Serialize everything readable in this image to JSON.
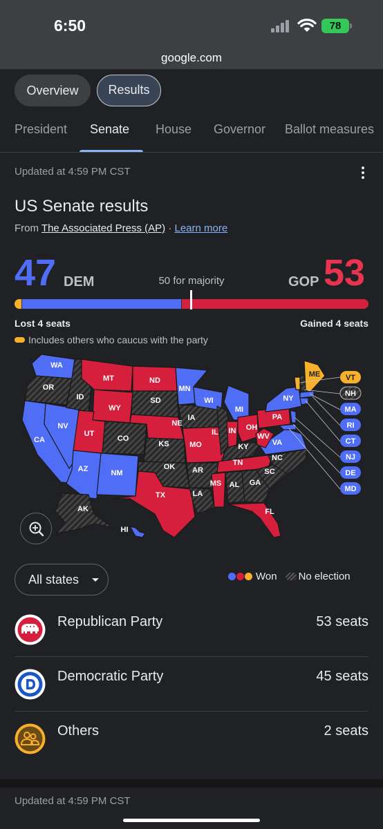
{
  "status": {
    "time": "6:50",
    "battery": "78"
  },
  "browser": {
    "url": "google.com"
  },
  "view_toggle": {
    "overview": "Overview",
    "results": "Results"
  },
  "race_tabs": [
    {
      "label": "President"
    },
    {
      "label": "Senate"
    },
    {
      "label": "House"
    },
    {
      "label": "Governor"
    },
    {
      "label": "Ballot measures"
    }
  ],
  "header": {
    "updated": "Updated at 4:59 PM CST",
    "title": "US Senate results",
    "source_prefix": "From",
    "source_name": "The Associated Press (AP)",
    "source_sep": "·",
    "learn_more": "Learn more"
  },
  "tally": {
    "dem_seats": "47",
    "dem_label": "DEM",
    "majority": "50 for majority",
    "gop_label": "GOP",
    "gop_seats": "53",
    "total_seats": 100,
    "bar": {
      "others": 2,
      "dem": 45,
      "gop": 53
    },
    "dem_change": "Lost 4 seats",
    "gop_change": "Gained 4 seats",
    "others_note": "Includes others who caucus with the party"
  },
  "colors": {
    "dem": "#4f6df5",
    "gop": "#d61f3c",
    "others": "#f6b02b",
    "no_election": "#2f2f2f"
  },
  "map": {
    "state_labels": [
      "WA",
      "OR",
      "MT",
      "ND",
      "ID",
      "MN",
      "WI",
      "MI",
      "NY",
      "ME",
      "SD",
      "WY",
      "NV",
      "CA",
      "UT",
      "CO",
      "NE",
      "IA",
      "IL",
      "IN",
      "OH",
      "PA",
      "KS",
      "MO",
      "KY",
      "WV",
      "VA",
      "NC",
      "TN",
      "AZ",
      "NM",
      "OK",
      "AR",
      "SC",
      "MS",
      "AL",
      "GA",
      "TX",
      "LA",
      "FL",
      "AK",
      "HI"
    ],
    "northeast_labels": [
      "VT",
      "NH",
      "MA",
      "RI",
      "CT",
      "NJ",
      "DE",
      "MD"
    ]
  },
  "filter": {
    "label": "All states"
  },
  "legend": {
    "won": "Won",
    "no_election": "No election"
  },
  "parties": [
    {
      "name": "Republican Party",
      "seats": "53 seats",
      "icon": "elephant-icon"
    },
    {
      "name": "Democratic Party",
      "seats": "45 seats",
      "icon": "donkey-d-icon"
    },
    {
      "name": "Others",
      "seats": "2 seats",
      "icon": "people-icon"
    }
  ],
  "footer": {
    "updated": "Updated at 4:59 PM CST"
  }
}
